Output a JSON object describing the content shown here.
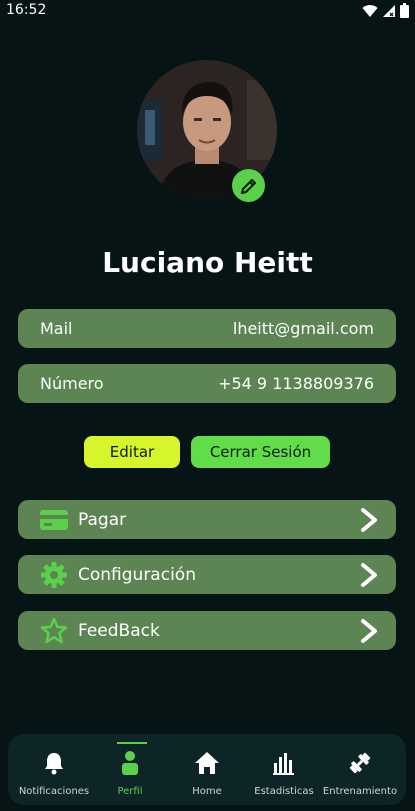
{
  "status_bar": {
    "time": "16:52"
  },
  "profile": {
    "name": "Luciano Heitt"
  },
  "info": [
    {
      "label": "Mail",
      "value": "lheitt@gmail.com"
    },
    {
      "label": "Número",
      "value": "+54 9 1138809376"
    }
  ],
  "actions": {
    "edit_label": "Editar",
    "logout_label": "Cerrar Sesión"
  },
  "menu": [
    {
      "label": "Pagar",
      "icon": "credit-card-icon"
    },
    {
      "label": "Configuración",
      "icon": "gear-icon"
    },
    {
      "label": "FeedBack",
      "icon": "star-icon"
    }
  ],
  "nav": [
    {
      "label": "Notificaciones",
      "icon": "bell-icon"
    },
    {
      "label": "Perfil",
      "icon": "user-icon",
      "active": true
    },
    {
      "label": "Home",
      "icon": "home-icon"
    },
    {
      "label": "Estadisticas",
      "icon": "bar-chart-icon"
    },
    {
      "label": "Entrenamiento",
      "icon": "training-icon"
    }
  ],
  "colors": {
    "background": "#071416",
    "card": "#5d8453",
    "accent_green": "#5bd04a",
    "accent_lime": "#d6f52a",
    "nav_background": "#0e2528"
  }
}
